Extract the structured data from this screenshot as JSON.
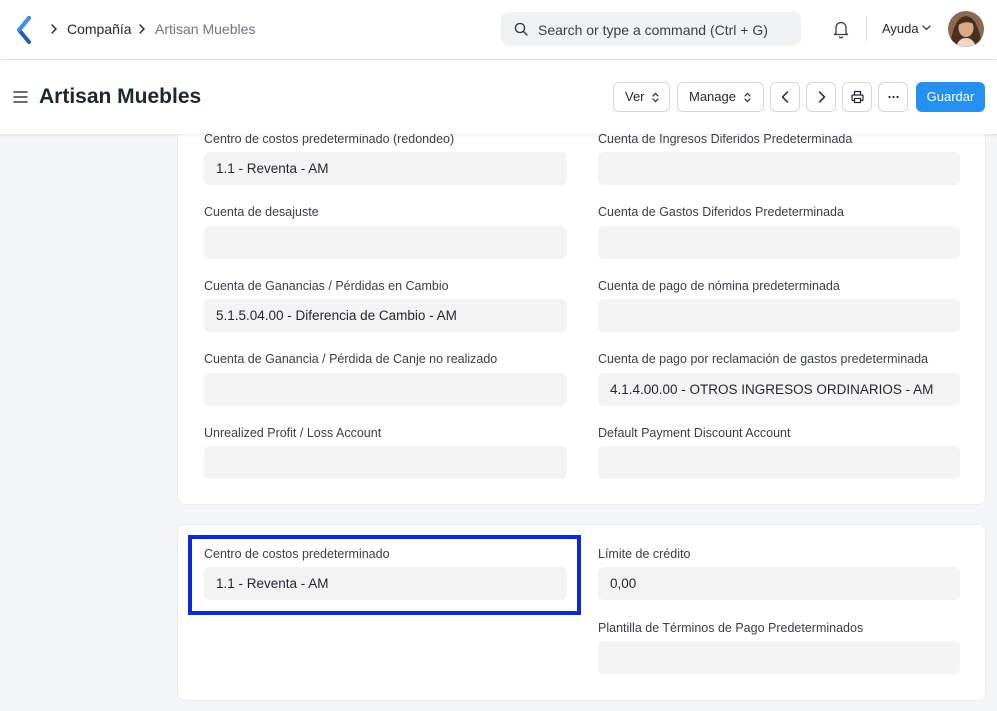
{
  "navbar": {
    "breadcrumbs": [
      "Compañía",
      "Artisan Muebles"
    ],
    "search_placeholder": "Search or type a command (Ctrl + G)",
    "help_label": "Ayuda",
    "icons": [
      "logo-icon",
      "search-icon",
      "bell-icon",
      "chevron-down-icon",
      "avatar"
    ]
  },
  "page_head": {
    "title": "Artisan Muebles",
    "view_label": "Ver",
    "manage_label": "Manage",
    "save_label": "Guardar",
    "accent_color": "#2490ef"
  },
  "section_accounts": {
    "left": [
      {
        "label": "Centro de costos predeterminado (redondeo)",
        "value": "1.1 - Reventa - AM"
      },
      {
        "label": "Cuenta de desajuste",
        "value": ""
      },
      {
        "label": "Cuenta de Ganancias / Pérdidas en Cambio",
        "value": "5.1.5.04.00 - Diferencia de Cambio - AM"
      },
      {
        "label": "Cuenta de Ganancia / Pérdida de Canje no realizado",
        "value": ""
      },
      {
        "label": "Unrealized Profit / Loss Account",
        "value": ""
      }
    ],
    "right": [
      {
        "label": "Cuenta de Ingresos Diferidos Predeterminada",
        "value": ""
      },
      {
        "label": "Cuenta de Gastos Diferidos Predeterminada",
        "value": ""
      },
      {
        "label": "Cuenta de pago de nómina predeterminada",
        "value": ""
      },
      {
        "label": "Cuenta de pago por reclamación de gastos predeterminada",
        "value": "4.1.4.00.00 - OTROS INGRESOS ORDINARIOS - AM"
      },
      {
        "label": "Default Payment Discount Account",
        "value": ""
      }
    ]
  },
  "section_credit": {
    "cost_center": {
      "label": "Centro de costos predeterminado",
      "value": "1.1 - Reventa - AM"
    },
    "credit_limit": {
      "label": "Límite de crédito",
      "value": "0,00"
    },
    "payment_terms": {
      "label": "Plantilla de Términos de Pago Predeterminados",
      "value": ""
    },
    "highlight_color": "#0b2bd6"
  }
}
